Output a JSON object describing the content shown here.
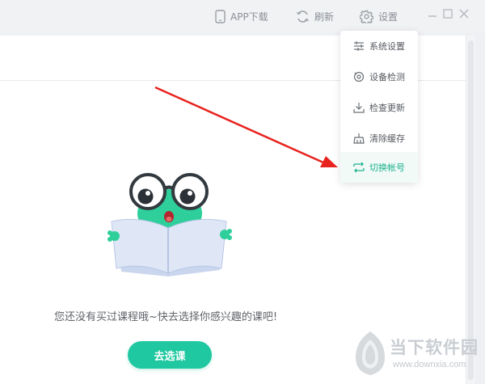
{
  "toolbar": {
    "app_download_label": "APP下载",
    "refresh_label": "刷新",
    "settings_label": "设置"
  },
  "settings_menu": {
    "items": [
      {
        "label": "系统设置",
        "icon": "sliders-icon",
        "active": false
      },
      {
        "label": "设备检测",
        "icon": "device-check-icon",
        "active": false
      },
      {
        "label": "检查更新",
        "icon": "download-icon",
        "active": false
      },
      {
        "label": "清除缓存",
        "icon": "broom-icon",
        "active": false
      },
      {
        "label": "切换帐号",
        "icon": "swap-icon",
        "active": true
      }
    ]
  },
  "empty_state": {
    "message": "您还没有买过课程哦~快去选择你感兴趣的课吧!",
    "button_label": "去选课"
  },
  "watermark": {
    "title": "当下软件园",
    "url": "www.downxia.com"
  },
  "colors": {
    "accent": "#1fc8a0",
    "arrow": "#e8231e"
  }
}
